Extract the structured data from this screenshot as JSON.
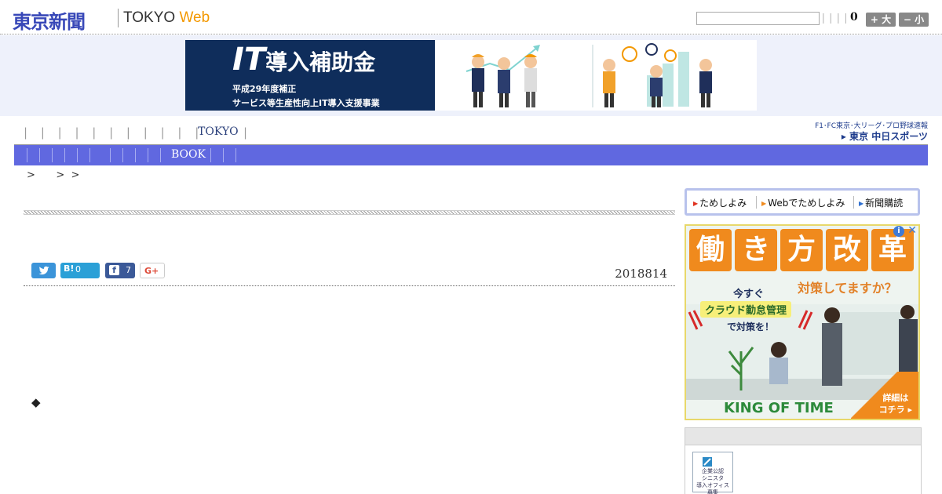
{
  "header": {
    "logo_shinbun": "東京新聞",
    "logo_tokyo": "TOKYO ",
    "logo_web": "Web",
    "search": {
      "value": "",
      "placeholder": ""
    },
    "dividers": "| | | |",
    "font_size_value": "0",
    "font_larger_label": "+ 大",
    "font_smaller_label": "− 小"
  },
  "top_ad": {
    "title_it": "IT",
    "title_rest": "導入補助金",
    "line1": "平成29年度補正",
    "line2": "サービス等生産性向上IT導入支援事業"
  },
  "nav": {
    "separators": "| | | | | | | | | | |",
    "tokyo_label": "TOKYO",
    "after_sep": "|",
    "chunichi_top": "F1･FC東京･大リーグ･プロ野球速報",
    "chunichi_bottom": "▸ 東京 中日スポーツ",
    "book_label": "BOOK"
  },
  "breadcrumb": ">    > >",
  "article": {
    "date": "2018814",
    "hatena_label": "B!",
    "hatena_count": "0",
    "facebook_label": "f",
    "facebook_count": "7",
    "gplus_label": "G+",
    "bullet": "◆"
  },
  "sidebar": {
    "tameshi_links": [
      "ためしよみ",
      "Webでためしよみ",
      "新聞購読"
    ],
    "ad": {
      "chars": [
        "働",
        "き",
        "方",
        "改",
        "革"
      ],
      "sub": "対策してますか？",
      "now": "今すぐ",
      "cloud": "クラウド勤怠管理",
      "taisaku": "で対策を！",
      "brand": "KING OF TIME",
      "cta": "詳細は\nコチラ ▸",
      "info": "i",
      "close": "✕"
    },
    "recruit_text": "企業公認\nシニスタ\n導入オフィス\n募集"
  },
  "colors": {
    "brand_blue": "#3848b8",
    "web_orange": "#f39800",
    "nav_bar": "#6068e0",
    "ad_navy": "#0f2d5b",
    "ad_orange": "#f08a1d"
  }
}
